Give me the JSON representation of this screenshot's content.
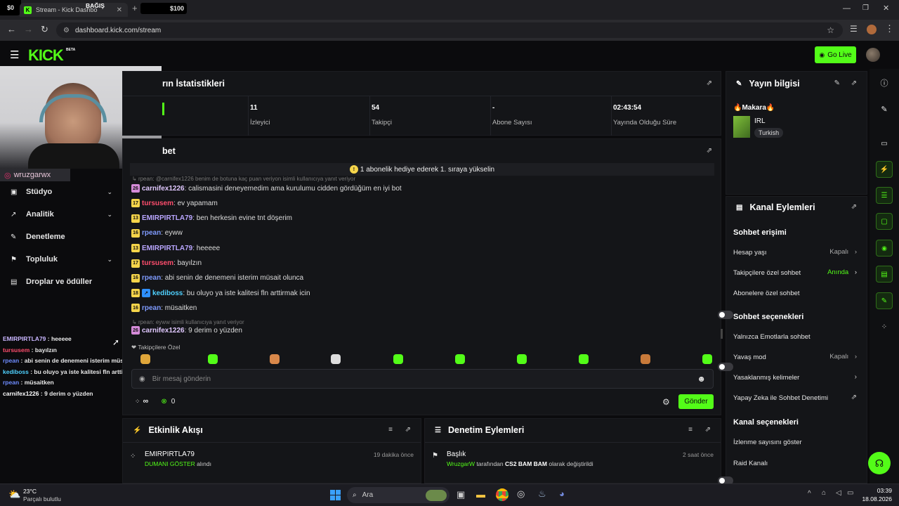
{
  "browser": {
    "tab_title": "Stream - Kick Dashbo",
    "url": "dashboard.kick.com/stream",
    "overlay_left": "$0",
    "overlay_donate": "BAĞIŞ",
    "overlay_amount": "$100"
  },
  "kick": {
    "logo": "KICK",
    "beta": "BETA",
    "go_live": "Go Live"
  },
  "overlay": {
    "instagram": "wruzgarwx",
    "chat": [
      {
        "user": "EMIRPIRTLA79",
        "text": " : heeeee",
        "color": "#c9b6ff"
      },
      {
        "user": "tursusem",
        "text": " : bayılzın",
        "color": "#ff4d6d"
      },
      {
        "user": "rpean",
        "text": " : abi senin de denemeni isterim müsait olunca",
        "color": "#6e8cff"
      },
      {
        "user": "kediboss",
        "text": " : bu oluyo ya iste kalitesi fln arttirmak icin",
        "color": "#4fd1ff"
      },
      {
        "user": "rpean",
        "text": " : müsaitken",
        "color": "#6e8cff"
      },
      {
        "user": "carnifex1226",
        "text": " : 9 derim o yüzden",
        "color": "#ffffff"
      }
    ]
  },
  "nav": {
    "items": [
      "Stüdyo",
      "Analitik",
      "Denetleme",
      "Topluluk",
      "Droplar ve ödüller"
    ]
  },
  "stats": {
    "title": "rın İstatistikleri",
    "cells": [
      {
        "value": "11",
        "label": "İzleyici"
      },
      {
        "value": "54",
        "label": "Takipçi"
      },
      {
        "value": "-",
        "label": "Abone Sayısı"
      },
      {
        "value": "02:43:54",
        "label": "Yayında Olduğu Süre"
      }
    ]
  },
  "chat": {
    "title": "bet",
    "pinned": "1 abonelik hediye ederek 1. sıraya yükselin",
    "reply_top": "rpean: @carnifex1226 benim de botuna kaç puan veriyon isimli kullanıcıya yanıt veriyor",
    "messages": [
      {
        "badge": "26",
        "user": "carnifex1226",
        "text": ": calismasini deneyemedim ama kurulumu cidden gördüğüm en iyi bot",
        "color": "#e0c8ff",
        "bcolor": "#d58bd9"
      },
      {
        "badge": "17",
        "user": "tursusem",
        "text": ": ev yapamam",
        "color": "#ff4d6d",
        "bcolor": "#f5d44a"
      },
      {
        "badge": "13",
        "user": "EMIRPIRTLA79",
        "text": ": ben herkesin evine tnt döşerim",
        "color": "#b9a6ff",
        "bcolor": "#f5d44a"
      },
      {
        "badge": "16",
        "user": "rpean",
        "text": ": eyww",
        "color": "#7f9bff",
        "bcolor": "#f5d44a"
      },
      {
        "badge": "13",
        "user": "EMIRPIRTLA79",
        "text": ": heeeee",
        "color": "#b9a6ff",
        "bcolor": "#f5d44a"
      },
      {
        "badge": "17",
        "user": "tursusem",
        "text": ": bayılzın",
        "color": "#ff4d6d",
        "bcolor": "#f5d44a"
      },
      {
        "badge": "16",
        "user": "rpean",
        "text": ": abi senin de denemeni isterim müsait olunca",
        "color": "#7f9bff",
        "bcolor": "#f5d44a"
      },
      {
        "badge": "18",
        "user": "kediboss",
        "text": ": bu oluyo ya iste kalitesi fln arttirmak icin",
        "color": "#4fd1ff",
        "bcolor": "#f5d44a"
      },
      {
        "badge": "16",
        "user": "rpean",
        "text": ": müsaitken",
        "color": "#7f9bff",
        "bcolor": "#f5d44a"
      }
    ],
    "reply_bottom": "rpean: eyww isimli kullanıcıya yanıt veriyor",
    "last": {
      "badge": "26",
      "user": "carnifex1226",
      "text": ": 9 derim o yüzden"
    },
    "followers_only": "Takipçilere Özel",
    "placeholder": "Bir mesaj gönderin",
    "points": "∞",
    "count": "0",
    "send": "Gönder"
  },
  "stream_info": {
    "title": "Yayın bilgisi",
    "stream_title": "Makara",
    "category": "IRL",
    "tag": "Turkish"
  },
  "channel_actions": {
    "title": "Kanal Eylemleri",
    "sec1": "Sohbet erişimi",
    "slow_label": "Hesap yaşı",
    "slow_value": "Kapalı",
    "followers_label": "Takipçilere özel sohbet",
    "followers_value": "Anında",
    "subs_label": "Abonelere özel sohbet",
    "sec2": "Sohbet seçenekleri",
    "emote_label": "Yalnızca Emotlarla sohbet",
    "slowmode_label": "Yavaş mod",
    "slowmode_value": "Kapalı",
    "banned_label": "Yasaklanmış kelimeler",
    "ai_label": "Yapay Zeka ile Sohbet Denetimi",
    "sec3": "Kanal seçenekleri",
    "viewcount_label": "İzlenme sayısını göster",
    "raid_label": "Raid Kanalı"
  },
  "activity": {
    "title": "Etkinlik Akışı",
    "user": "EMIRPIRTLA79",
    "action_hl": "DUMANI GÖSTER",
    "action": " alındı",
    "time": "19 dakika önce"
  },
  "moderation": {
    "title": "Denetim Eylemleri",
    "heading": "Başlık",
    "user": "WruzgarW",
    "mid": " tarafından ",
    "value": "CS2 BAM BAM",
    "tail": " olarak değiştirildi",
    "time": "2 saat önce"
  },
  "taskbar": {
    "temp": "23°C",
    "weather": "Parçalı bulutlu",
    "search": "Ara",
    "time": "03:39",
    "date": "18.08.2026"
  },
  "colors": {
    "accent": "#53fc18",
    "panel": "#141518",
    "bg": "#0b0b0d"
  }
}
